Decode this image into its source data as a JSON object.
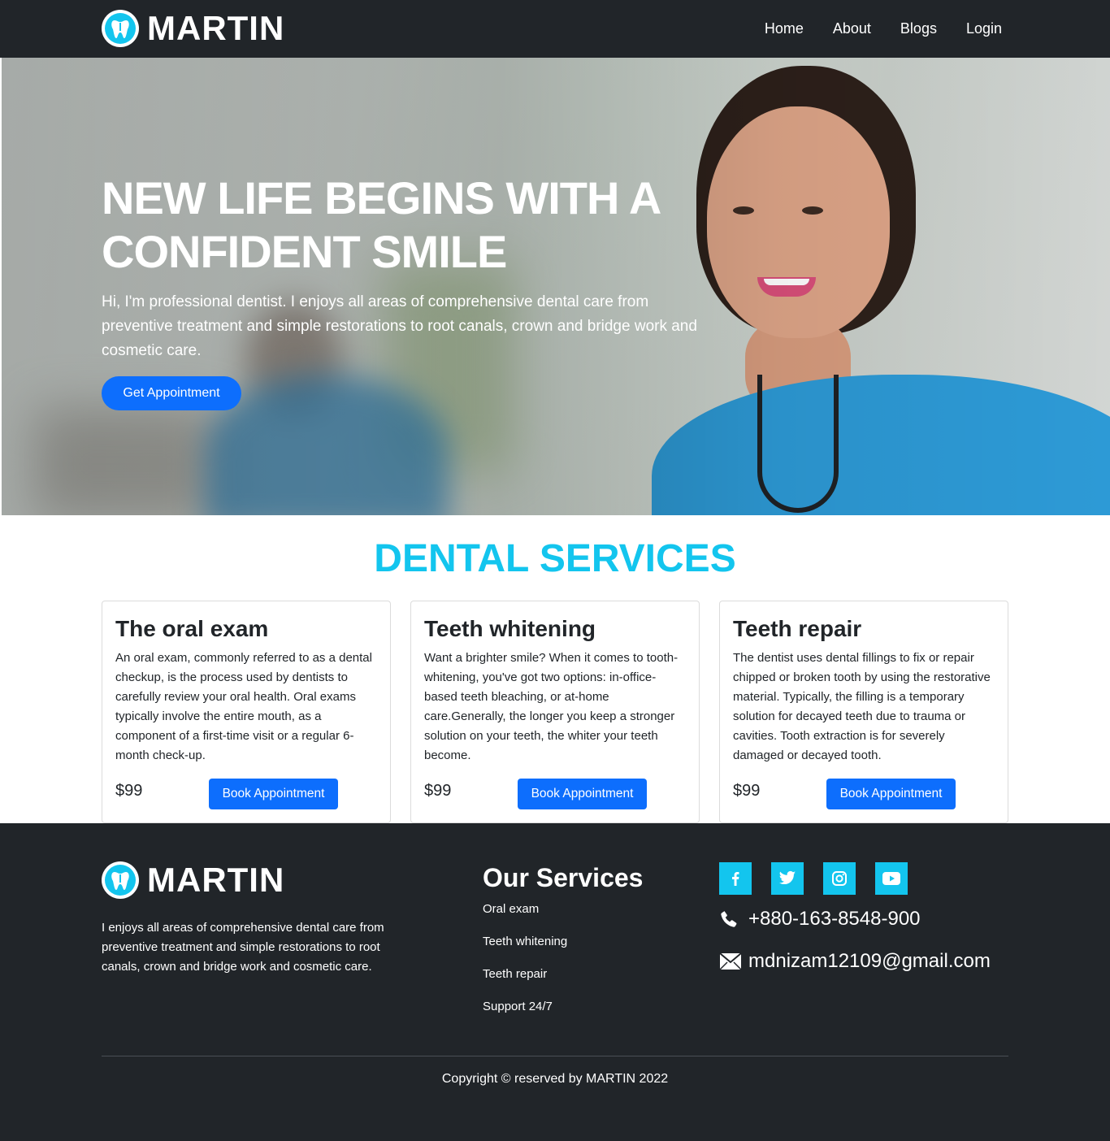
{
  "brand": {
    "name": "MARTIN",
    "logo_icon": "tooth-icon"
  },
  "nav": {
    "items": [
      {
        "label": "Home"
      },
      {
        "label": "About"
      },
      {
        "label": "Blogs"
      },
      {
        "label": "Login"
      }
    ]
  },
  "hero": {
    "title": "NEW LIFE BEGINS WITH A CONFIDENT SMILE",
    "text": "Hi, I'm professional dentist. I enjoys all areas of comprehensive dental care from preventive treatment and simple restorations to root canals, crown and bridge work and cosmetic care.",
    "button": "Get Appointment"
  },
  "services": {
    "title": "DENTAL SERVICES",
    "cards": [
      {
        "title": "The oral exam",
        "text": "An oral exam, commonly referred to as a dental checkup, is the process used by dentists to carefully review your oral health. Oral exams typically involve the entire mouth, as a component of a first-time visit or a regular 6-month check-up.",
        "price": "$99",
        "button": "Book Appointment"
      },
      {
        "title": "Teeth whitening",
        "text": "Want a brighter smile? When it comes to tooth-whitening, you've got two options: in-office-based teeth bleaching, or at-home care.Generally, the longer you keep a stronger solution on your teeth, the whiter your teeth become.",
        "price": "$99",
        "button": "Book Appointment"
      },
      {
        "title": "Teeth repair",
        "text": "The dentist uses dental fillings to fix or repair chipped or broken tooth by using the restorative material. Typically, the filling is a temporary solution for decayed teeth due to trauma or cavities. Tooth extraction is for severely damaged or decayed tooth.",
        "price": "$99",
        "button": "Book Appointment"
      }
    ]
  },
  "footer": {
    "brand": "MARTIN",
    "about": "I enjoys all areas of comprehensive dental care from preventive treatment and simple restorations to root canals, crown and bridge work and cosmetic care.",
    "services_title": "Our Services",
    "services_links": [
      {
        "label": "Oral exam"
      },
      {
        "label": "Teeth whitening"
      },
      {
        "label": "Teeth repair"
      },
      {
        "label": "Support 24/7"
      }
    ],
    "socials": [
      {
        "icon": "facebook-icon"
      },
      {
        "icon": "twitter-icon"
      },
      {
        "icon": "instagram-icon"
      },
      {
        "icon": "youtube-icon"
      }
    ],
    "phone": "+880-163-8548-900",
    "email": "mdnizam12109@gmail.com",
    "copyright": "Copyright © reserved by MARTIN 2022"
  },
  "colors": {
    "dark": "#212529",
    "accent": "#13c5ee",
    "primary": "#0d6efd",
    "scrubs": "#2d9ad6"
  }
}
